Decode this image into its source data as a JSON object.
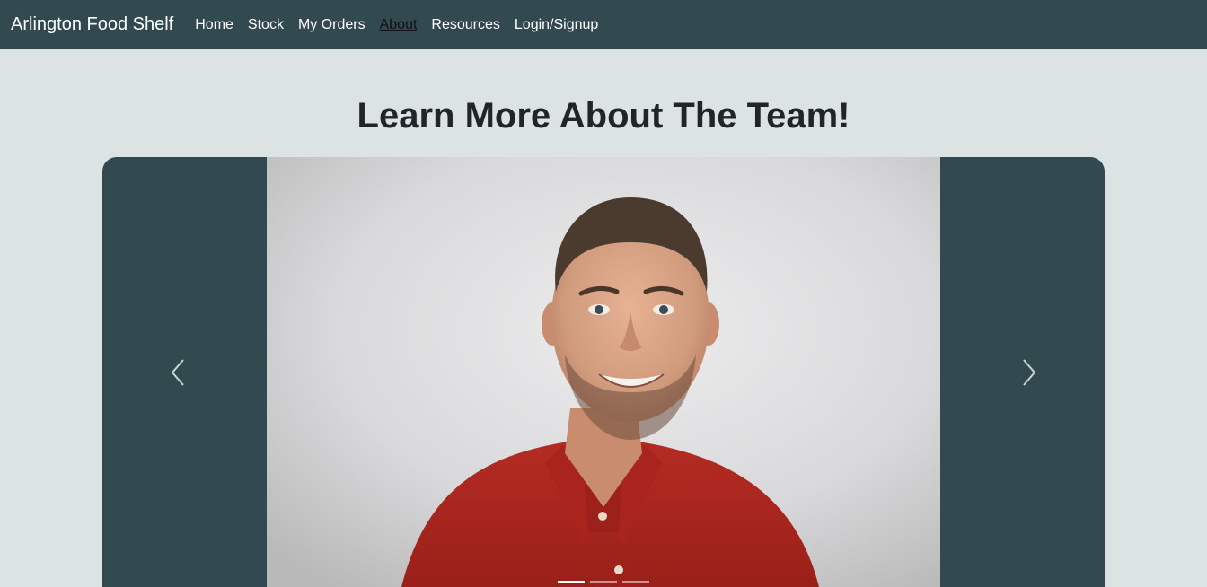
{
  "navbar": {
    "brand": "Arlington Food Shelf",
    "links": [
      {
        "label": "Home",
        "active": false
      },
      {
        "label": "Stock",
        "active": false
      },
      {
        "label": "My Orders",
        "active": false
      },
      {
        "label": "About",
        "active": true
      },
      {
        "label": "Resources",
        "active": false
      },
      {
        "label": "Login/Signup",
        "active": false
      }
    ]
  },
  "page": {
    "title": "Learn More About The Team!"
  },
  "carousel": {
    "slides_count": 3,
    "active_slide": 1,
    "photo_subject": "smiling man in red polo shirt",
    "prev_icon": "chevron-left-icon",
    "next_icon": "chevron-right-icon"
  },
  "colors": {
    "navbar_bg": "#324950",
    "page_bg": "#dbe4e3",
    "title_text": "#212529",
    "shirt_red": "#b32a22"
  }
}
